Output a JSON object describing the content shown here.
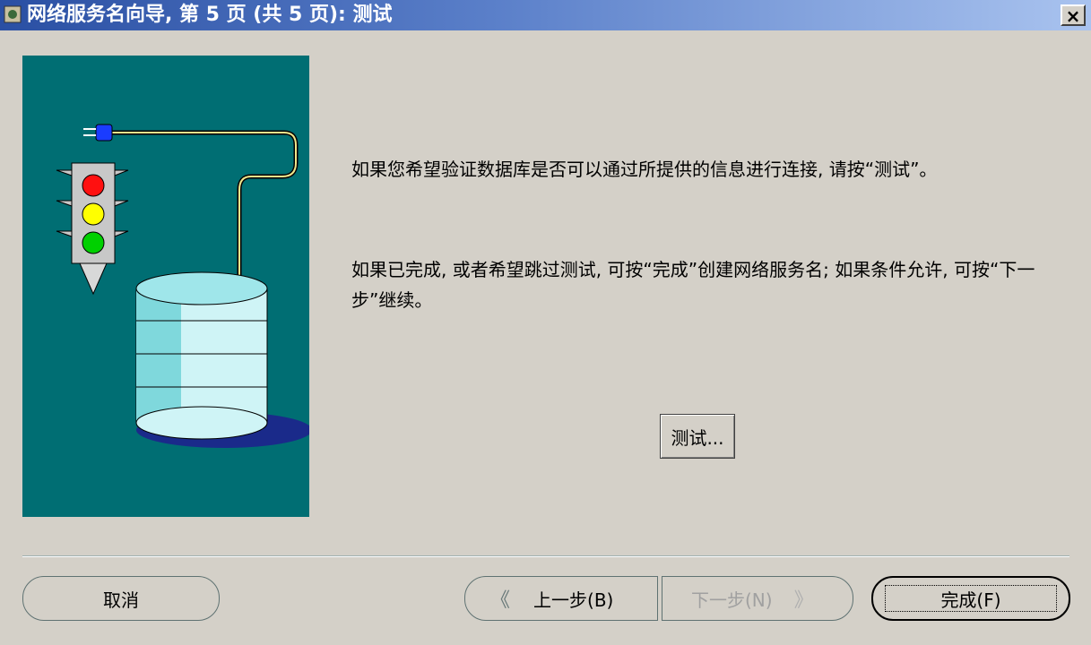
{
  "window": {
    "title": "网络服务名向导, 第 5 页 (共 5 页): 测试",
    "close_label": "×"
  },
  "content": {
    "message_1": "如果您希望验证数据库是否可以通过所提供的信息进行连接, 请按“测试”。",
    "message_2": "如果已完成, 或者希望跳过测试, 可按“完成”创建网络服务名; 如果条件允许, 可按“下一步”继续。",
    "test_button": "测试..."
  },
  "footer": {
    "cancel": "取消",
    "back": "上一步(B)",
    "next": "下一步(N)",
    "finish": "完成(F)",
    "back_chevron": "《",
    "next_chevron": "》"
  },
  "colors": {
    "title_start": "#2a4fa3",
    "title_end": "#a9c3ef",
    "dialog_bg": "#d4d0c8",
    "illustration_bg": "#006e73"
  },
  "icons": [
    "app-icon",
    "close-icon",
    "traffic-light-icon",
    "database-icon",
    "plug-icon"
  ]
}
